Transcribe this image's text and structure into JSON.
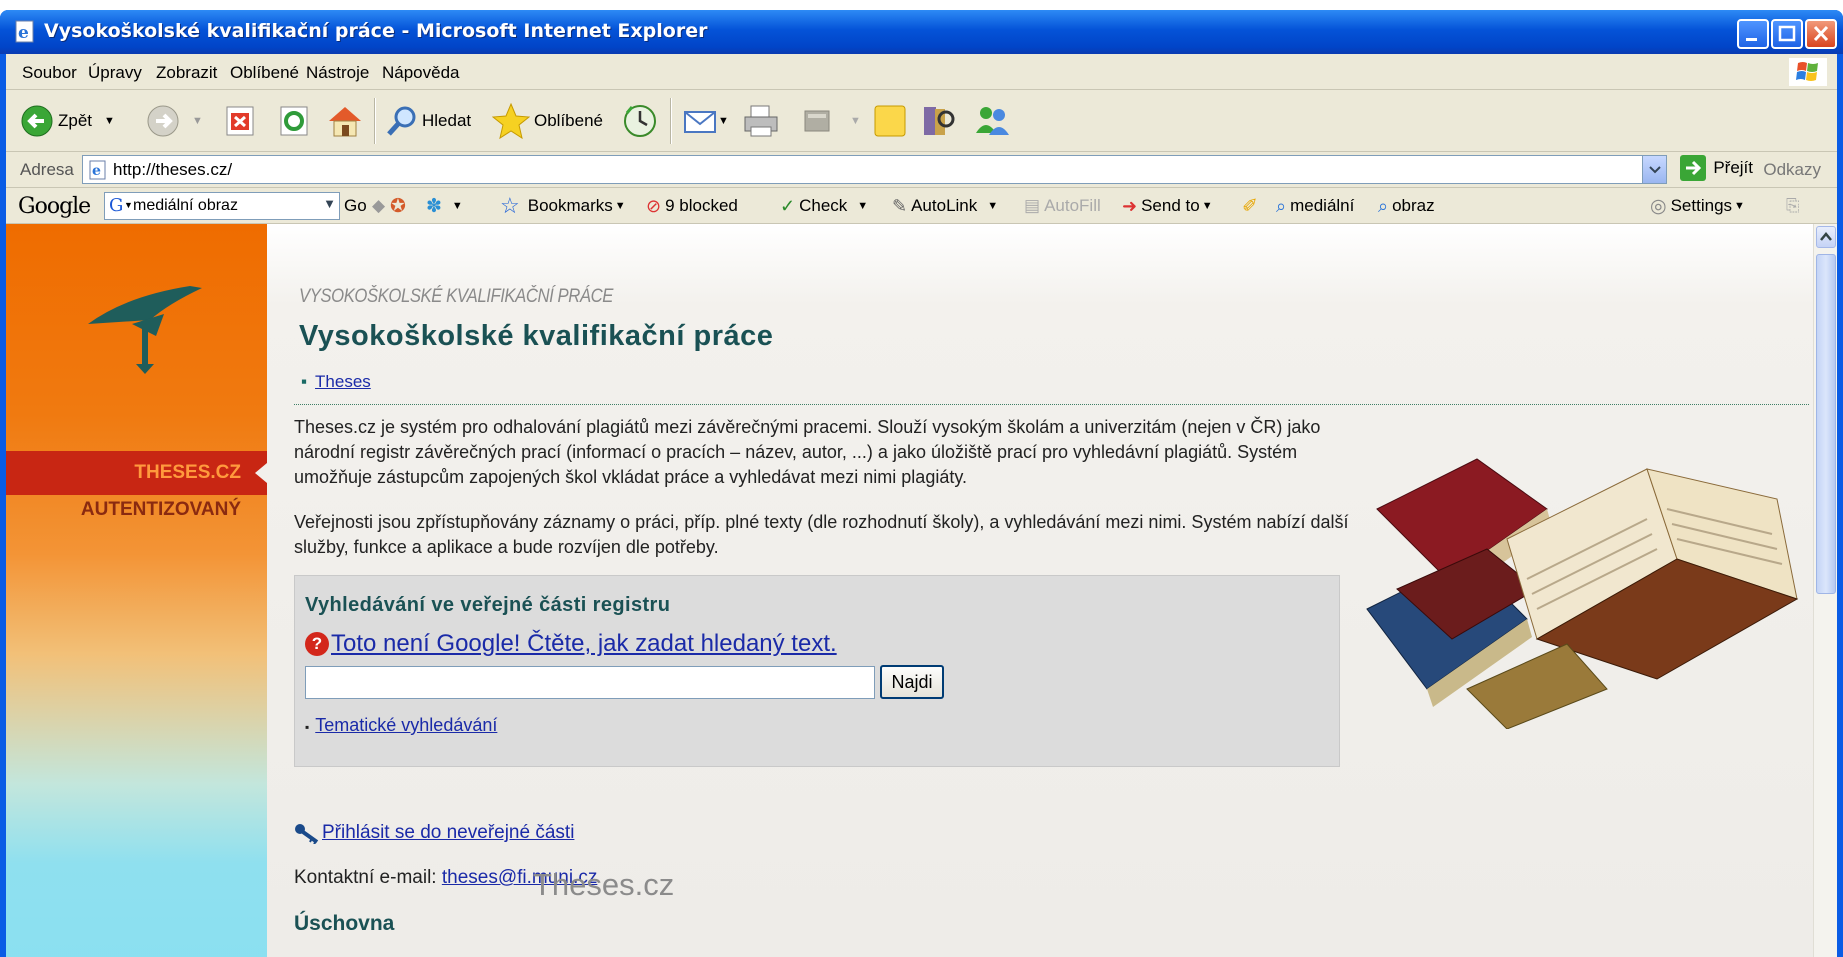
{
  "window": {
    "title": "Vysokoškolské kvalifikační práce - Microsoft Internet Explorer",
    "colors": {
      "titlebar": "#0453d8",
      "chrome": "#ece9d8"
    }
  },
  "menubar": {
    "items": [
      "Soubor",
      "Úpravy",
      "Zobrazit",
      "Oblíbené",
      "Nástroje",
      "Nápověda"
    ]
  },
  "toolbar": {
    "back_label": "Zpět",
    "search_label": "Hledat",
    "favorites_label": "Oblíbené"
  },
  "addressbar": {
    "label": "Adresa",
    "url": "http://theses.cz/",
    "go_label": "Přejít",
    "links_label": "Odkazy"
  },
  "googlebar": {
    "logo": "Google",
    "query": "mediální obraz",
    "go_label": "Go",
    "bookmarks_label": "Bookmarks",
    "blocked_label": "9 blocked",
    "check_label": "Check",
    "autolink_label": "AutoLink",
    "autofill_label": "AutoFill",
    "sendto_label": "Send to",
    "term1": "mediální",
    "term2": "obraz",
    "settings_label": "Settings"
  },
  "sidebar": {
    "nav_active": "THESES.CZ",
    "nav_second": "AUTENTIZOVANÝ",
    "colors": {
      "orange": "#ef6c00",
      "active": "#c82613",
      "cyan": "#88dff2"
    }
  },
  "main": {
    "kicker": "VYSOKOŠKOLSKÉ KVALIFIKAČNÍ PRÁCE",
    "title": "Vysokoškolské kvalifikační práce",
    "breadcrumb": "Theses",
    "para1": "Theses.cz je systém pro odhalování plagiátů mezi závěrečnými pracemi. Slouží vysokým školám a univerzitám (nejen v ČR) jako národní registr závěrečných prací (informací o pracích – název, autor, ...) a jako úložiště prací pro vyhledávní plagiátů. Systém umožňuje zástupcům zapojených škol vkládat práce a vyhledávat mezi nimi plagiáty.",
    "para2": "Veřejnosti jsou zpřístupňovány záznamy o práci, příp. plné texty (dle rozhodnutí školy), a vyhledávání mezi nimi. Systém nabízí další služby, funkce a aplikace a bude rozvíjen dle potřeby.",
    "search": {
      "title": "Vyhledávání ve veřejné části registru",
      "help_link": " Toto není Google! Čtěte, jak zadat hledaný text.",
      "button": "Najdi",
      "input_value": "",
      "topic_link": "Tematické vyhledávání"
    },
    "login_link": "Přihlásit se do neveřejné části",
    "contact_label": "Kontaktní e-mail: ",
    "contact_email": "theses@fi.muni.cz",
    "overlay_caption": "Theses.cz",
    "section_heading": "Úschovna"
  }
}
